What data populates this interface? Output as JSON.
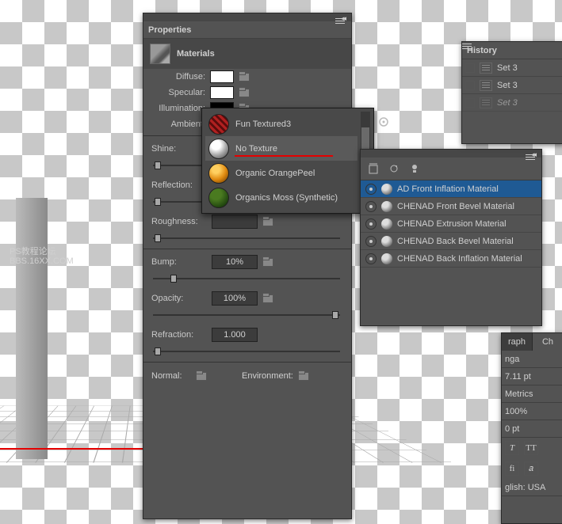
{
  "properties": {
    "panel_title": "Properties",
    "section_title": "Materials",
    "diffuse_label": "Diffuse:",
    "specular_label": "Specular:",
    "illumination_label": "Illumination:",
    "ambient_label": "Ambient:",
    "shine": {
      "label": "Shine:",
      "value": ""
    },
    "reflection": {
      "label": "Reflection:",
      "value": ""
    },
    "roughness": {
      "label": "Roughness:",
      "value": ""
    },
    "bump": {
      "label": "Bump:",
      "value": "10%"
    },
    "opacity": {
      "label": "Opacity:",
      "value": "100%"
    },
    "refraction": {
      "label": "Refraction:",
      "value": "1.000"
    },
    "normal_label": "Normal:",
    "environment_label": "Environment:"
  },
  "texture_picker": {
    "items": [
      {
        "name": "Fun Textured3",
        "thumb": "diag-red"
      },
      {
        "name": "No Texture",
        "thumb": "sphere-grey"
      },
      {
        "name": "Organic OrangePeel",
        "thumb": "sphere-orange"
      },
      {
        "name": "Organics Moss (Synthetic)",
        "thumb": "sphere-green"
      }
    ]
  },
  "materials_panel": {
    "items": [
      "AD Front Inflation Material",
      "CHENAD Front Bevel Material",
      "CHENAD Extrusion Material",
      "CHENAD Back Bevel Material",
      "CHENAD Back Inflation Material"
    ]
  },
  "history": {
    "panel_title": "History",
    "items": [
      {
        "label": "Set 3",
        "dim": false
      },
      {
        "label": "Set 3",
        "dim": false
      },
      {
        "label": "Set 3",
        "dim": true
      }
    ]
  },
  "char_panel": {
    "tab1": "raph",
    "tab2": "Ch",
    "font_row": "nga",
    "size": "7.11 pt",
    "kerning": "Metrics",
    "scale": "100%",
    "baseline": "0 pt",
    "lang": "glish: USA"
  },
  "watermark": {
    "line1": "PS教程论坛",
    "line2": "BBS.16XX.COM"
  }
}
